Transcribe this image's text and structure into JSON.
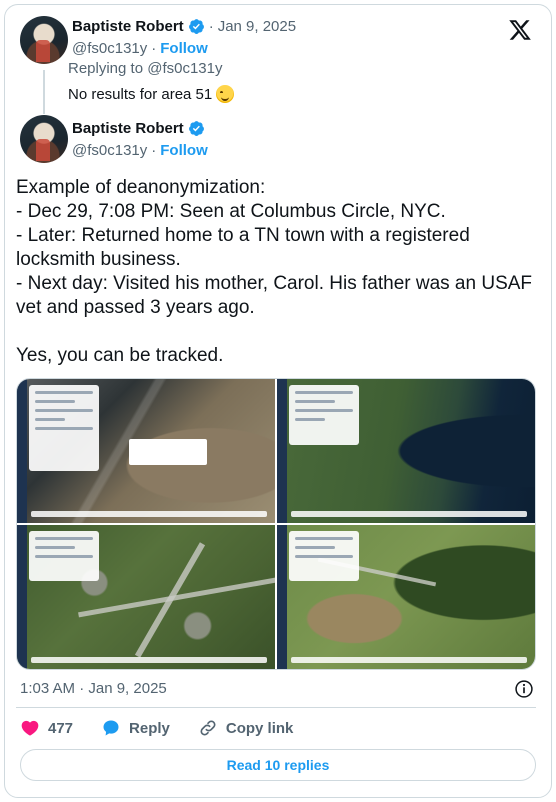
{
  "parent_tweet": {
    "author_name": "Baptiste Robert",
    "timestamp": "Jan 9, 2025",
    "handle": "@fs0c131y",
    "follow_label": "Follow",
    "replying_to": "Replying to @fs0c131y",
    "text": "No results for area 51",
    "emoji": "sweat-smile-emoji"
  },
  "main_tweet": {
    "author_name": "Baptiste Robert",
    "handle": "@fs0c131y",
    "follow_label": "Follow",
    "text": "Example of deanonymization:\n- Dec 29, 7:08 PM: Seen at Columbus Circle, NYC.\n- Later: Returned home to a TN town with a registered locksmith business.\n- Next day: Visited his mother, Carol. His father was an USAF vet and passed 3 years ago.\n\nYes, you can be tracked.",
    "media": [
      "city-satellite-map",
      "northeast-us-satellite-map",
      "suburb-satellite-map",
      "rural-property-satellite-map"
    ],
    "timestamp": "1:03 AM · Jan 9, 2025"
  },
  "actions": {
    "like_count": "477",
    "reply_label": "Reply",
    "copy_link_label": "Copy link"
  },
  "read_replies_label": "Read 10 replies",
  "colors": {
    "accent": "#1d9bf0",
    "like": "#f91880",
    "muted": "#536471",
    "border": "#cfd9de"
  }
}
